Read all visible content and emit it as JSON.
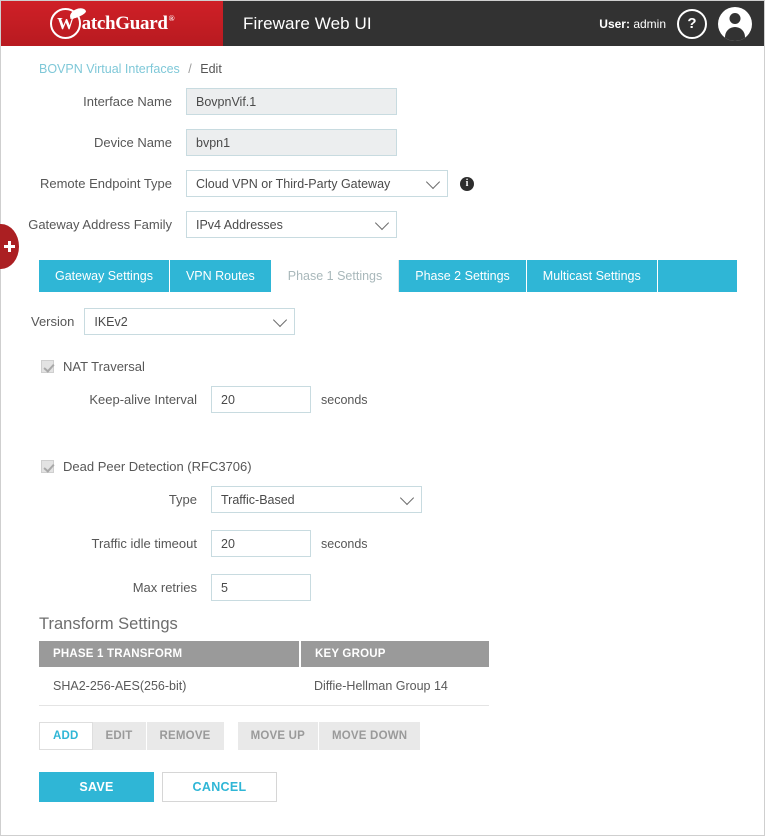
{
  "header": {
    "logo_text": "atchGuard",
    "logo_initial": "W",
    "app_title": "Fireware Web UI",
    "user_prefix": "User:",
    "user_name": "admin",
    "help_glyph": "?",
    "brand_red": "#c8202a",
    "bar_dark": "#323232"
  },
  "side_tab": {
    "name": "expand-handle"
  },
  "breadcrumb": {
    "parent": "BOVPN Virtual Interfaces",
    "separator": "/",
    "current": "Edit"
  },
  "form": {
    "interface_name": {
      "label": "Interface Name",
      "value": "BovpnVif.1"
    },
    "device_name": {
      "label": "Device Name",
      "value": "bvpn1"
    },
    "remote_endpoint_type": {
      "label": "Remote Endpoint Type",
      "value": "Cloud VPN or Third-Party Gateway"
    },
    "gateway_address_family": {
      "label": "Gateway Address Family",
      "value": "IPv4 Addresses"
    }
  },
  "tabs": [
    {
      "label": "Gateway Settings",
      "active": false
    },
    {
      "label": "VPN Routes",
      "active": false
    },
    {
      "label": "Phase 1 Settings",
      "active": true
    },
    {
      "label": "Phase 2 Settings",
      "active": false
    },
    {
      "label": "Multicast Settings",
      "active": false
    }
  ],
  "phase1": {
    "version": {
      "label": "Version",
      "value": "IKEv2"
    },
    "nat_traversal": {
      "label": "NAT Traversal",
      "checked": true
    },
    "keepalive": {
      "label": "Keep-alive Interval",
      "value": "20",
      "unit": "seconds"
    },
    "dpd": {
      "label": "Dead Peer Detection (RFC3706)",
      "checked": true
    },
    "dpd_type": {
      "label": "Type",
      "value": "Traffic-Based"
    },
    "traffic_idle_timeout": {
      "label": "Traffic idle timeout",
      "value": "20",
      "unit": "seconds"
    },
    "max_retries": {
      "label": "Max retries",
      "value": "5"
    }
  },
  "transform": {
    "title": "Transform Settings",
    "columns": [
      "PHASE 1 TRANSFORM",
      "KEY GROUP"
    ],
    "rows": [
      [
        "SHA2-256-AES(256-bit)",
        "Diffie-Hellman Group 14"
      ]
    ],
    "buttons_left": [
      {
        "label": "ADD",
        "enabled": true
      },
      {
        "label": "EDIT",
        "enabled": false
      },
      {
        "label": "REMOVE",
        "enabled": false
      }
    ],
    "buttons_right": [
      {
        "label": "MOVE UP",
        "enabled": false
      },
      {
        "label": "MOVE DOWN",
        "enabled": false
      }
    ]
  },
  "footer": {
    "save": "SAVE",
    "cancel": "CANCEL",
    "accent": "#2fb6d6"
  }
}
